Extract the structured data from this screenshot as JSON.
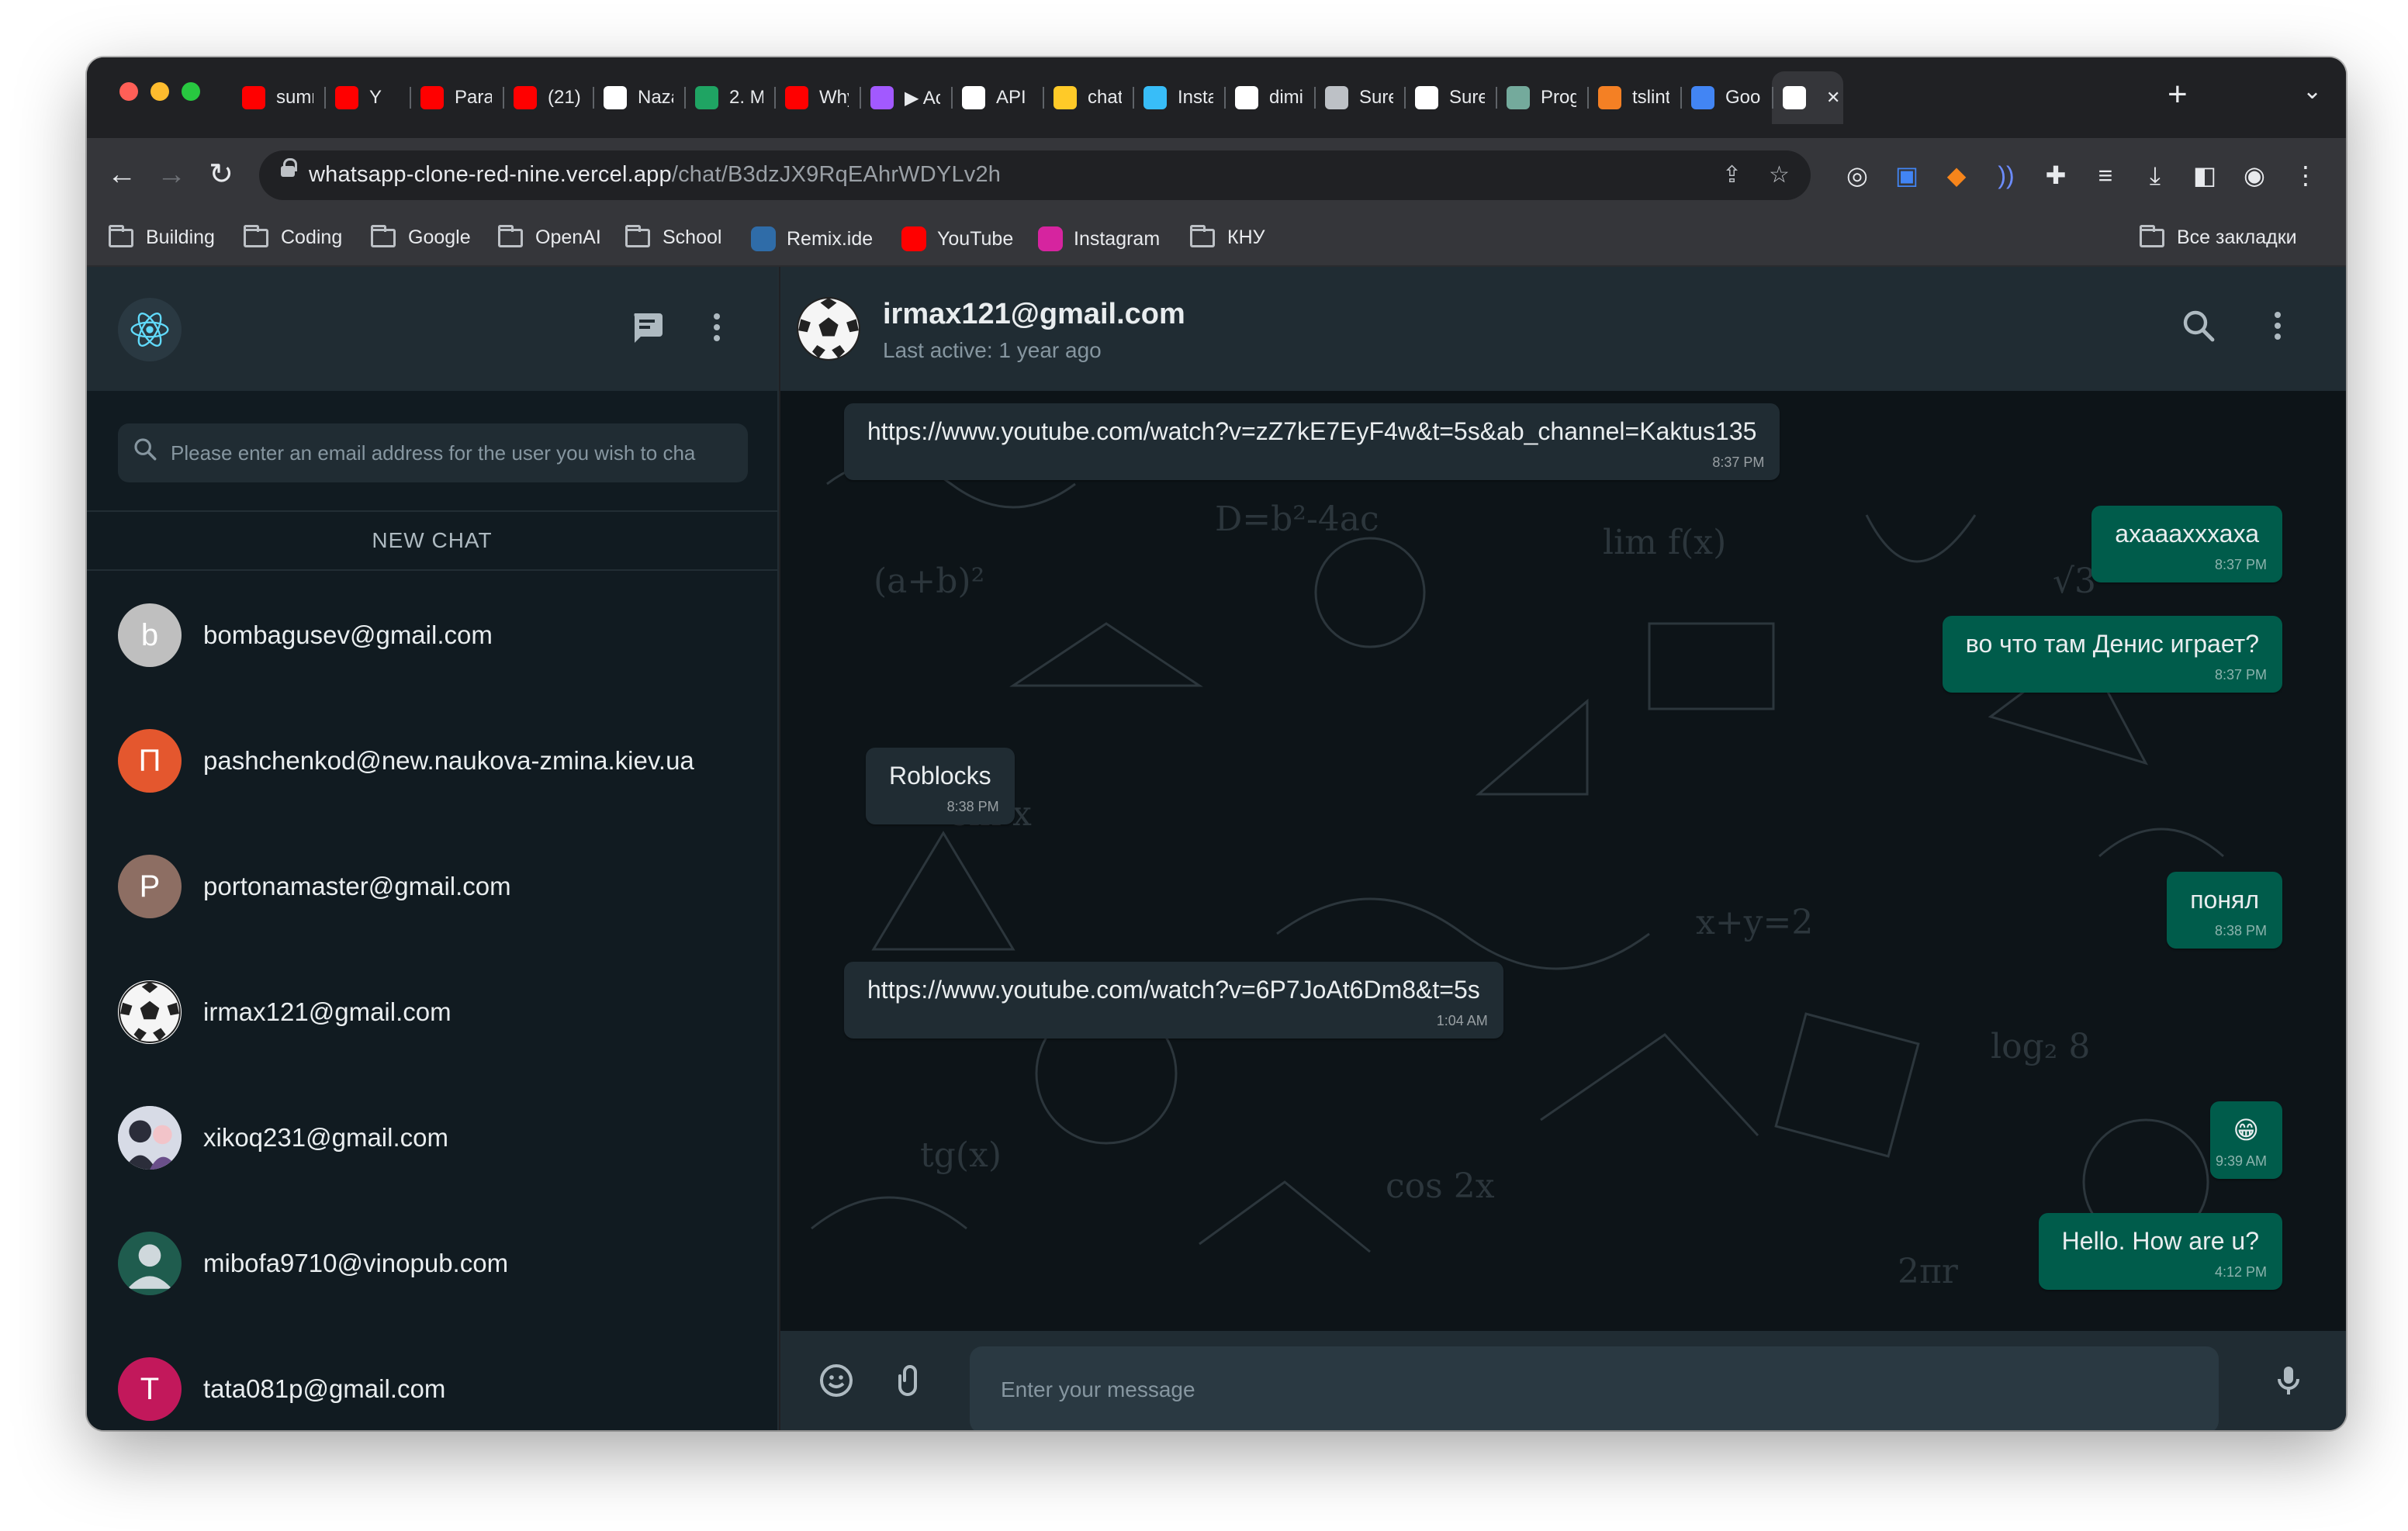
{
  "browser": {
    "tabs": [
      {
        "title": "sumr",
        "icon": "youtube-icon",
        "color": "#ff0000"
      },
      {
        "title": "Y",
        "icon": "youtube-music-icon",
        "color": "#ff0000"
      },
      {
        "title": "Paral",
        "icon": "youtube-icon",
        "color": "#ff0000"
      },
      {
        "title": "(21)",
        "icon": "youtube-icon",
        "color": "#ff0000"
      },
      {
        "title": "Naza",
        "icon": "github-icon",
        "color": "#ffffff"
      },
      {
        "title": "2. M",
        "icon": "google-drive-icon",
        "color": "#1fa463"
      },
      {
        "title": "Why",
        "icon": "youtube-icon",
        "color": "#ff0000"
      },
      {
        "title": "▶ Ac",
        "icon": "figma-icon",
        "color": "#a259ff"
      },
      {
        "title": "API k",
        "icon": "openai-icon",
        "color": "#ffffff"
      },
      {
        "title": "chat",
        "icon": "firebase-icon",
        "color": "#ffca28"
      },
      {
        "title": "Insta",
        "icon": "tailwind-icon",
        "color": "#38bdf8"
      },
      {
        "title": "dimi",
        "icon": "github-icon",
        "color": "#ffffff"
      },
      {
        "title": "Sure",
        "icon": "globe-icon",
        "color": "#bdc1c6"
      },
      {
        "title": "Sure",
        "icon": "github-icon",
        "color": "#ffffff"
      },
      {
        "title": "Prog",
        "icon": "chatgpt-icon",
        "color": "#74aa9c"
      },
      {
        "title": "tslint",
        "icon": "stackoverflow-icon",
        "color": "#f48024"
      },
      {
        "title": "Goog",
        "icon": "google-translate-icon",
        "color": "#4285f4"
      },
      {
        "title": "(",
        "icon": "vercel-icon",
        "color": "#ffffff",
        "active": true
      }
    ],
    "url_host": "whatsapp-clone-red-nine.vercel.app",
    "url_path": "/chat/B3dzJX9RqEAhrWDYLv2h",
    "bookmarks": [
      {
        "label": "Building",
        "type": "folder"
      },
      {
        "label": "Coding",
        "type": "folder"
      },
      {
        "label": "Google",
        "type": "folder"
      },
      {
        "label": "OpenAI",
        "type": "folder"
      },
      {
        "label": "School",
        "type": "folder"
      },
      {
        "label": "Remix.ide",
        "type": "site",
        "color": "#2f6ca8"
      },
      {
        "label": "YouTube",
        "type": "site",
        "color": "#ff0000"
      },
      {
        "label": "Instagram",
        "type": "site",
        "color": "#d6249f"
      },
      {
        "label": "КНУ",
        "type": "folder"
      }
    ],
    "all_bookmarks": "Все закладки"
  },
  "sidebar": {
    "search_placeholder": "Please enter an email address for the user you wish to cha",
    "new_chat": "NEW CHAT",
    "chats": [
      {
        "email": "bombagusev@gmail.com",
        "initial": "b",
        "avatar_color": "#bfbfbf",
        "avatar_type": "letter"
      },
      {
        "email": "pashchenkod@new.naukova-zmina.kiev.ua",
        "initial": "П",
        "avatar_color": "#e4572e",
        "avatar_type": "letter"
      },
      {
        "email": "portonamaster@gmail.com",
        "initial": "P",
        "avatar_color": "#8d6e63",
        "avatar_type": "letter"
      },
      {
        "email": "irmax121@gmail.com",
        "initial": "",
        "avatar_color": "#ffffff",
        "avatar_type": "soccer-ball"
      },
      {
        "email": "xikoq231@gmail.com",
        "initial": "",
        "avatar_color": "#d7dbe6",
        "avatar_type": "photo"
      },
      {
        "email": "mibofa9710@vinopub.com",
        "initial": "",
        "avatar_color": "#1f5c4e",
        "avatar_type": "default-person"
      },
      {
        "email": "tata081p@gmail.com",
        "initial": "T",
        "avatar_color": "#c2185b",
        "avatar_type": "letter"
      }
    ]
  },
  "conversation": {
    "name": "irmax121@gmail.com",
    "status": "Last active: 1 year ago",
    "composer_placeholder": "Enter your message",
    "messages": [
      {
        "text": "https://www.youtube.com/watch?v=zZ7kE7EyF4w&t=5s&ab_channel=Kaktus135",
        "time": "8:37 PM",
        "dir": "in"
      },
      {
        "text": "ахааахххаха",
        "time": "8:37 PM",
        "dir": "out"
      },
      {
        "text": "во что там Денис играет?",
        "time": "8:37 PM",
        "dir": "out"
      },
      {
        "text": "Roblocks",
        "time": "8:38 PM",
        "dir": "in"
      },
      {
        "text": "понял",
        "time": "8:38 PM",
        "dir": "out"
      },
      {
        "text": "https://www.youtube.com/watch?v=6P7JoAt6Dm8&t=5s",
        "time": "1:04 AM",
        "dir": "in"
      },
      {
        "text": "😁",
        "time": "9:39 AM",
        "dir": "out"
      },
      {
        "text": "Hello. How are u?",
        "time": "4:12 PM",
        "dir": "out"
      }
    ]
  },
  "colors": {
    "panel": "#202c33",
    "sidebar_bg": "#111b21",
    "incoming_bubble": "#202c33",
    "outgoing_bubble": "#005c4b",
    "text": "#e9edef",
    "muted": "#8696a0"
  }
}
